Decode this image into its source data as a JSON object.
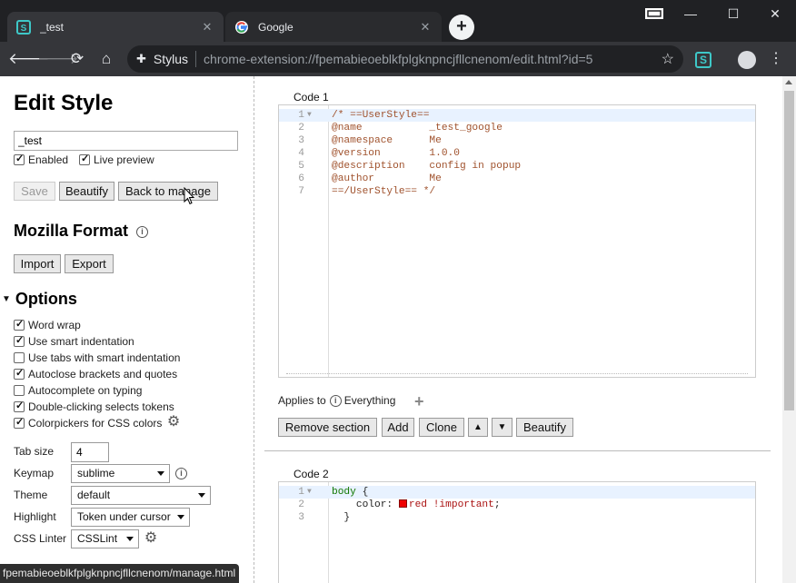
{
  "browser": {
    "tabs": [
      {
        "title": "_test",
        "favicon": "stylus-icon",
        "active": true
      },
      {
        "title": "Google",
        "favicon": "google-icon",
        "active": false
      }
    ],
    "new_tab": "+",
    "omnibox": {
      "ext_name": "Stylus",
      "url": "chrome-extension://fpemabieoeblkfplgknpncjfllcnenom/edit.html?id=5"
    },
    "status_url": "fpemabieoeblkfplgknpncjfllcnenom/manage.html"
  },
  "left": {
    "title": "Edit Style",
    "style_name": "_test",
    "enabled_label": "Enabled",
    "enabled": true,
    "live_preview_label": "Live preview",
    "live_preview": true,
    "buttons": {
      "save": "Save",
      "beautify": "Beautify",
      "back": "Back to manage"
    },
    "mozilla_format": {
      "title": "Mozilla Format",
      "import": "Import",
      "export": "Export"
    },
    "options": {
      "title": "Options",
      "items": [
        {
          "label": "Word wrap",
          "checked": true
        },
        {
          "label": "Use smart indentation",
          "checked": true
        },
        {
          "label": "Use tabs with smart indentation",
          "checked": false
        },
        {
          "label": "Autoclose brackets and quotes",
          "checked": true
        },
        {
          "label": "Autocomplete on typing",
          "checked": false
        },
        {
          "label": "Double-clicking selects tokens",
          "checked": true
        },
        {
          "label": "Colorpickers for CSS colors",
          "checked": true
        }
      ],
      "tab_size_label": "Tab size",
      "tab_size": "4",
      "keymap_label": "Keymap",
      "keymap": "sublime",
      "theme_label": "Theme",
      "theme": "default",
      "highlight_label": "Highlight",
      "highlight": "Token under cursor",
      "linter_label": "CSS Linter",
      "linter": "CSSLint"
    }
  },
  "sections": [
    {
      "label": "Code 1",
      "lines": [
        {
          "n": "1",
          "parts": [
            [
              "cmt",
              "/* ==UserStyle=="
            ]
          ]
        },
        {
          "n": "2",
          "parts": [
            [
              "cmt",
              "@name           _test_google"
            ]
          ]
        },
        {
          "n": "3",
          "parts": [
            [
              "cmt",
              "@namespace      Me"
            ]
          ]
        },
        {
          "n": "4",
          "parts": [
            [
              "cmt",
              "@version        1.0.0"
            ]
          ]
        },
        {
          "n": "5",
          "parts": [
            [
              "cmt",
              "@description    config in popup"
            ]
          ]
        },
        {
          "n": "6",
          "parts": [
            [
              "cmt",
              "@author         Me"
            ]
          ]
        },
        {
          "n": "7",
          "parts": [
            [
              "cmt",
              "==/UserStyle== */"
            ]
          ]
        }
      ],
      "applies_to_label": "Applies to",
      "applies_to_value": "Everything",
      "buttons": {
        "remove": "Remove section",
        "add": "Add",
        "clone": "Clone",
        "up": "▲",
        "down": "▼",
        "beautify": "Beautify"
      }
    },
    {
      "label": "Code 2",
      "lines": [
        {
          "n": "1",
          "parts": [
            [
              "tag",
              "body"
            ],
            [
              "prop",
              " {"
            ]
          ]
        },
        {
          "n": "2",
          "parts": [
            [
              "prop",
              "    color: "
            ],
            [
              "swatch",
              ""
            ],
            [
              "val",
              "red !important"
            ],
            [
              "prop",
              ";"
            ]
          ]
        },
        {
          "n": "3",
          "parts": [
            [
              "prop",
              "  }"
            ]
          ]
        }
      ]
    }
  ],
  "colors": {
    "tab_strip": "#202124",
    "toolbar": "#35363a",
    "stylus_accent": "#3ec8c8",
    "comment": "#a0522d",
    "swatch_red": "#ee0000"
  }
}
